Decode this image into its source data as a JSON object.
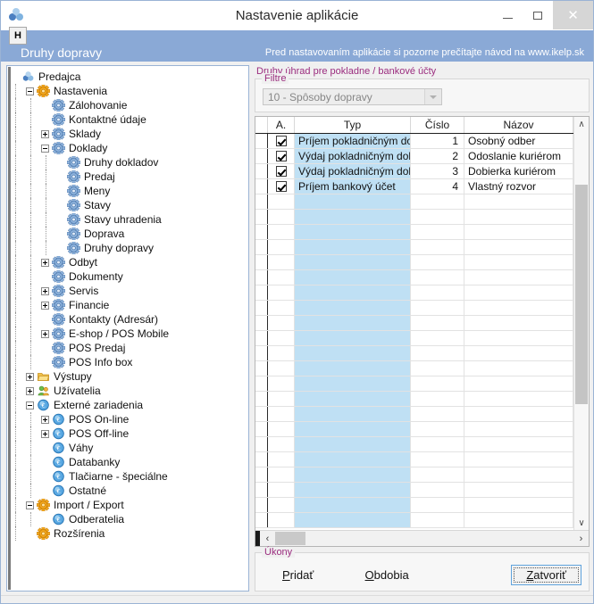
{
  "window": {
    "title": "Nastavenie aplikácie",
    "icon": "app-logo-icon",
    "minimize_label": "—",
    "maximize_label": "□",
    "close_label": "✕"
  },
  "menu": {
    "items": [
      "H"
    ]
  },
  "banner": {
    "title": "Druhy dopravy",
    "note": "Pred nastavovaním aplikácie si pozorne prečítajte návod na www.ikelp.sk"
  },
  "tree": {
    "items": [
      {
        "label": "Predajca",
        "depth": 0,
        "expander": "none",
        "icon": "app-logo-icon"
      },
      {
        "label": "Nastavenia",
        "depth": 1,
        "expander": "minus",
        "icon": "orange-gear-icon"
      },
      {
        "label": "Zálohovanie",
        "depth": 2,
        "expander": "leaf",
        "icon": "blue-gear-icon"
      },
      {
        "label": "Kontaktné údaje",
        "depth": 2,
        "expander": "leaf",
        "icon": "blue-gear-icon"
      },
      {
        "label": "Sklady",
        "depth": 2,
        "expander": "plus",
        "icon": "blue-gear-icon"
      },
      {
        "label": "Doklady",
        "depth": 2,
        "expander": "minus",
        "icon": "blue-gear-icon"
      },
      {
        "label": "Druhy dokladov",
        "depth": 3,
        "expander": "leaf",
        "icon": "blue-gear-icon"
      },
      {
        "label": "Predaj",
        "depth": 3,
        "expander": "leaf",
        "icon": "blue-gear-icon"
      },
      {
        "label": "Meny",
        "depth": 3,
        "expander": "leaf",
        "icon": "blue-gear-icon"
      },
      {
        "label": "Stavy",
        "depth": 3,
        "expander": "leaf",
        "icon": "blue-gear-icon"
      },
      {
        "label": "Stavy uhradenia",
        "depth": 3,
        "expander": "leaf",
        "icon": "blue-gear-icon"
      },
      {
        "label": "Doprava",
        "depth": 3,
        "expander": "leaf",
        "icon": "blue-gear-icon"
      },
      {
        "label": "Druhy dopravy",
        "depth": 3,
        "expander": "leaf",
        "icon": "blue-gear-icon"
      },
      {
        "label": "Odbyt",
        "depth": 2,
        "expander": "plus",
        "icon": "blue-gear-icon"
      },
      {
        "label": "Dokumenty",
        "depth": 2,
        "expander": "leaf",
        "icon": "blue-gear-icon"
      },
      {
        "label": "Servis",
        "depth": 2,
        "expander": "plus",
        "icon": "blue-gear-icon"
      },
      {
        "label": "Financie",
        "depth": 2,
        "expander": "plus",
        "icon": "blue-gear-icon"
      },
      {
        "label": "Kontakty (Adresár)",
        "depth": 2,
        "expander": "leaf",
        "icon": "blue-gear-icon"
      },
      {
        "label": "E-shop / POS Mobile",
        "depth": 2,
        "expander": "plus",
        "icon": "blue-gear-icon"
      },
      {
        "label": "POS Predaj",
        "depth": 2,
        "expander": "leaf",
        "icon": "blue-gear-icon"
      },
      {
        "label": "POS Info box",
        "depth": 2,
        "expander": "leaf",
        "icon": "blue-gear-icon"
      },
      {
        "label": "Výstupy",
        "depth": 1,
        "expander": "plus",
        "icon": "folder-icon"
      },
      {
        "label": "Užívatelia",
        "depth": 1,
        "expander": "plus",
        "icon": "users-icon"
      },
      {
        "label": "Externé zariadenia",
        "depth": 1,
        "expander": "minus",
        "icon": "euro-circle-icon"
      },
      {
        "label": "POS On-line",
        "depth": 2,
        "expander": "plus",
        "icon": "euro-circle-icon"
      },
      {
        "label": "POS Off-line",
        "depth": 2,
        "expander": "plus",
        "icon": "euro-circle-icon"
      },
      {
        "label": "Váhy",
        "depth": 2,
        "expander": "leaf",
        "icon": "euro-circle-icon"
      },
      {
        "label": "Databanky",
        "depth": 2,
        "expander": "leaf",
        "icon": "euro-circle-icon"
      },
      {
        "label": "Tlačiarne - špeciálne",
        "depth": 2,
        "expander": "leaf",
        "icon": "euro-circle-icon"
      },
      {
        "label": "Ostatné",
        "depth": 2,
        "expander": "leaf",
        "icon": "euro-circle-icon"
      },
      {
        "label": "Import / Export",
        "depth": 1,
        "expander": "minus",
        "icon": "orange-gear-icon"
      },
      {
        "label": "Odberatelia",
        "depth": 2,
        "expander": "leaf",
        "icon": "euro-circle-icon"
      },
      {
        "label": "Rozšírenia",
        "depth": 1,
        "expander": "leaf",
        "icon": "orange-gear-icon"
      }
    ]
  },
  "main": {
    "group_title": "Druhy úhrad pre pokladne / bankové účty",
    "filter": {
      "legend": "Filtre",
      "selected": "10 - Spôsoby dopravy",
      "disabled": true
    },
    "grid": {
      "columns": [
        "A.",
        "Typ",
        "Číslo",
        "Názov"
      ],
      "rows": [
        {
          "checked": true,
          "typ": "Príjem pokladničným dokladom",
          "cislo": "1",
          "nazov": "Osobný odber"
        },
        {
          "checked": true,
          "typ": "Výdaj pokladničným dokladom",
          "cislo": "2",
          "nazov": "Odoslanie kuriérom"
        },
        {
          "checked": true,
          "typ": "Výdaj pokladničným dokladom",
          "cislo": "3",
          "nazov": "Dobierka kuriérom"
        },
        {
          "checked": true,
          "typ": "Príjem bankový účet",
          "cislo": "4",
          "nazov": "Vlastný rozvor"
        }
      ],
      "scroll_up_label": "∧",
      "scroll_down_label": "∨",
      "scroll_left_label": "‹",
      "scroll_right_label": "›"
    }
  },
  "actions": {
    "legend": "Úkony",
    "add_label": "Pridať",
    "periods_label": "Obdobia",
    "close_label": "Zatvoriť"
  },
  "colors": {
    "banner": "#8aa9d6",
    "legend_text": "#9b2d7f",
    "selected_column": "#bfe0f4",
    "window_border": "#9ab3d5",
    "focus_button_border": "#5fa3dd"
  }
}
